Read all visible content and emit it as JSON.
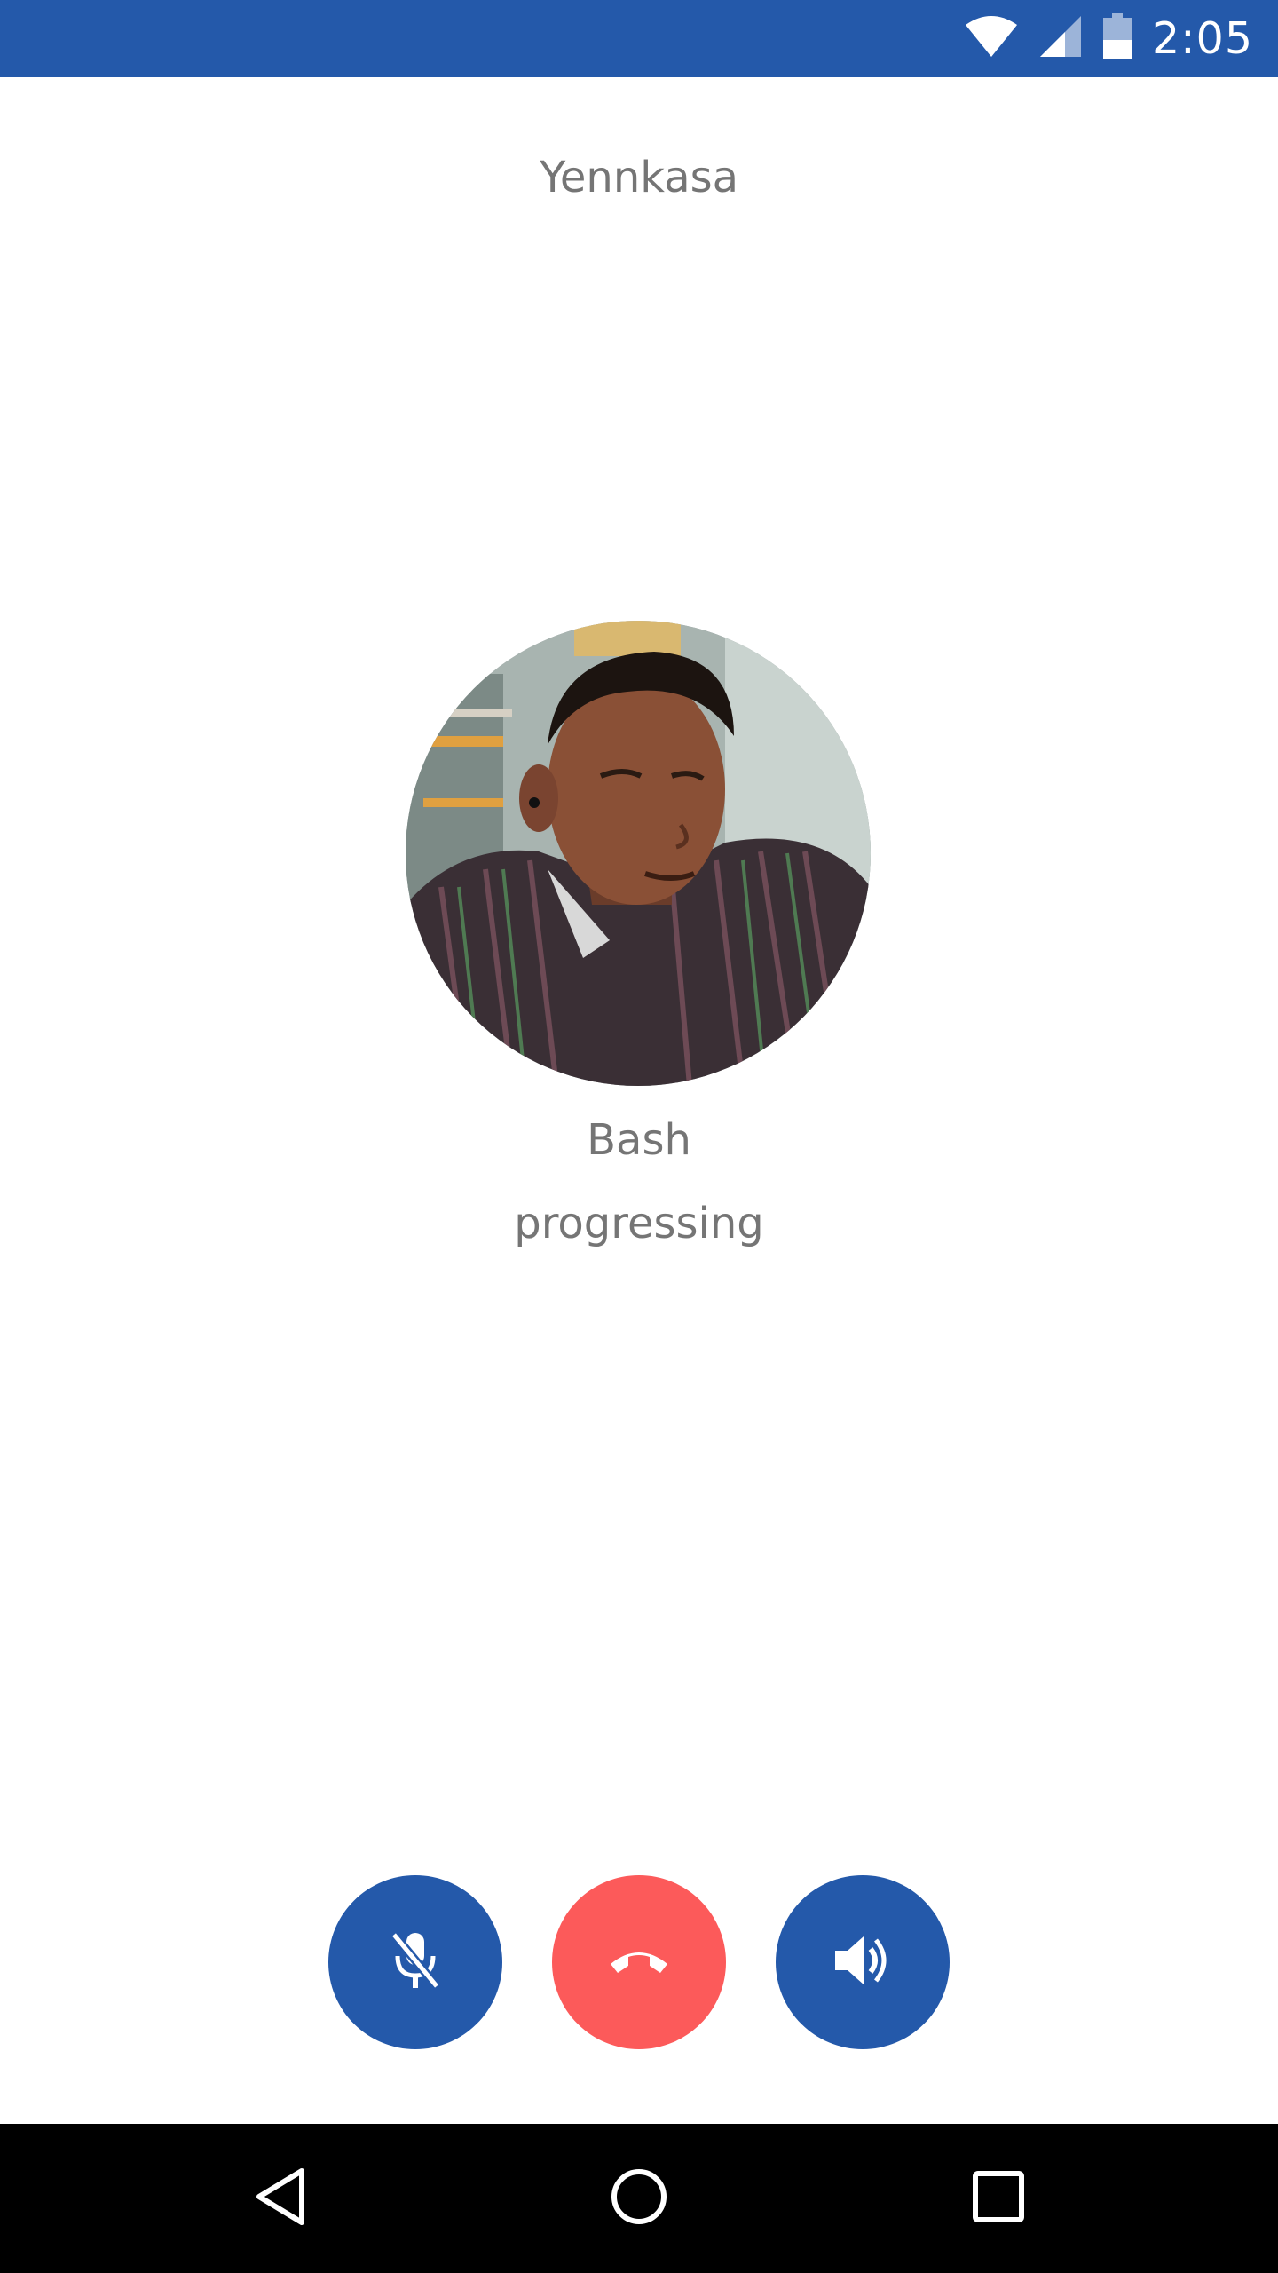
{
  "status_bar": {
    "time": "2:05",
    "icons": [
      "wifi-icon",
      "cell-signal-icon",
      "battery-icon"
    ],
    "background": "#2459aa"
  },
  "app": {
    "title": "Yennkasa"
  },
  "call": {
    "caller_name": "Bash",
    "status": "progressing",
    "avatar": "caller-photo"
  },
  "controls": {
    "mute": {
      "icon": "mic-off-icon",
      "color": "#2459aa"
    },
    "end_call": {
      "icon": "call-end-icon",
      "color": "#fc5a5a"
    },
    "speaker": {
      "icon": "speaker-icon",
      "color": "#2459aa"
    }
  },
  "nav_bar": {
    "icons": [
      "back-icon",
      "home-icon",
      "recents-icon"
    ]
  }
}
